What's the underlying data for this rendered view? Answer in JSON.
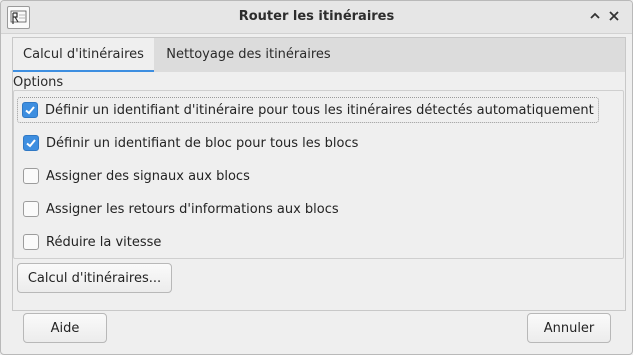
{
  "window": {
    "title": "Router les itinéraires"
  },
  "tabs": [
    {
      "label": "Calcul d'itinéraires",
      "active": true
    },
    {
      "label": "Nettoyage des itinéraires",
      "active": false
    }
  ],
  "options": {
    "title": "Options",
    "items": [
      {
        "label": "Définir un identifiant d'itinéraire pour tous les itinéraires détectés automatiquement",
        "checked": true
      },
      {
        "label": "Définir un identifiant de bloc pour tous les blocs",
        "checked": true
      },
      {
        "label": "Assigner des signaux aux blocs",
        "checked": false
      },
      {
        "label": "Assigner les retours d'informations aux blocs",
        "checked": false
      },
      {
        "label": "Réduire la vitesse",
        "checked": false
      }
    ]
  },
  "buttons": {
    "calc": "Calcul d'itinéraires...",
    "help": "Aide",
    "cancel": "Annuler"
  },
  "colors": {
    "accent": "#3d8ee0"
  },
  "icons": {
    "app": "app-logo-icon",
    "minimize": "chevron-up-icon",
    "close": "close-icon"
  }
}
